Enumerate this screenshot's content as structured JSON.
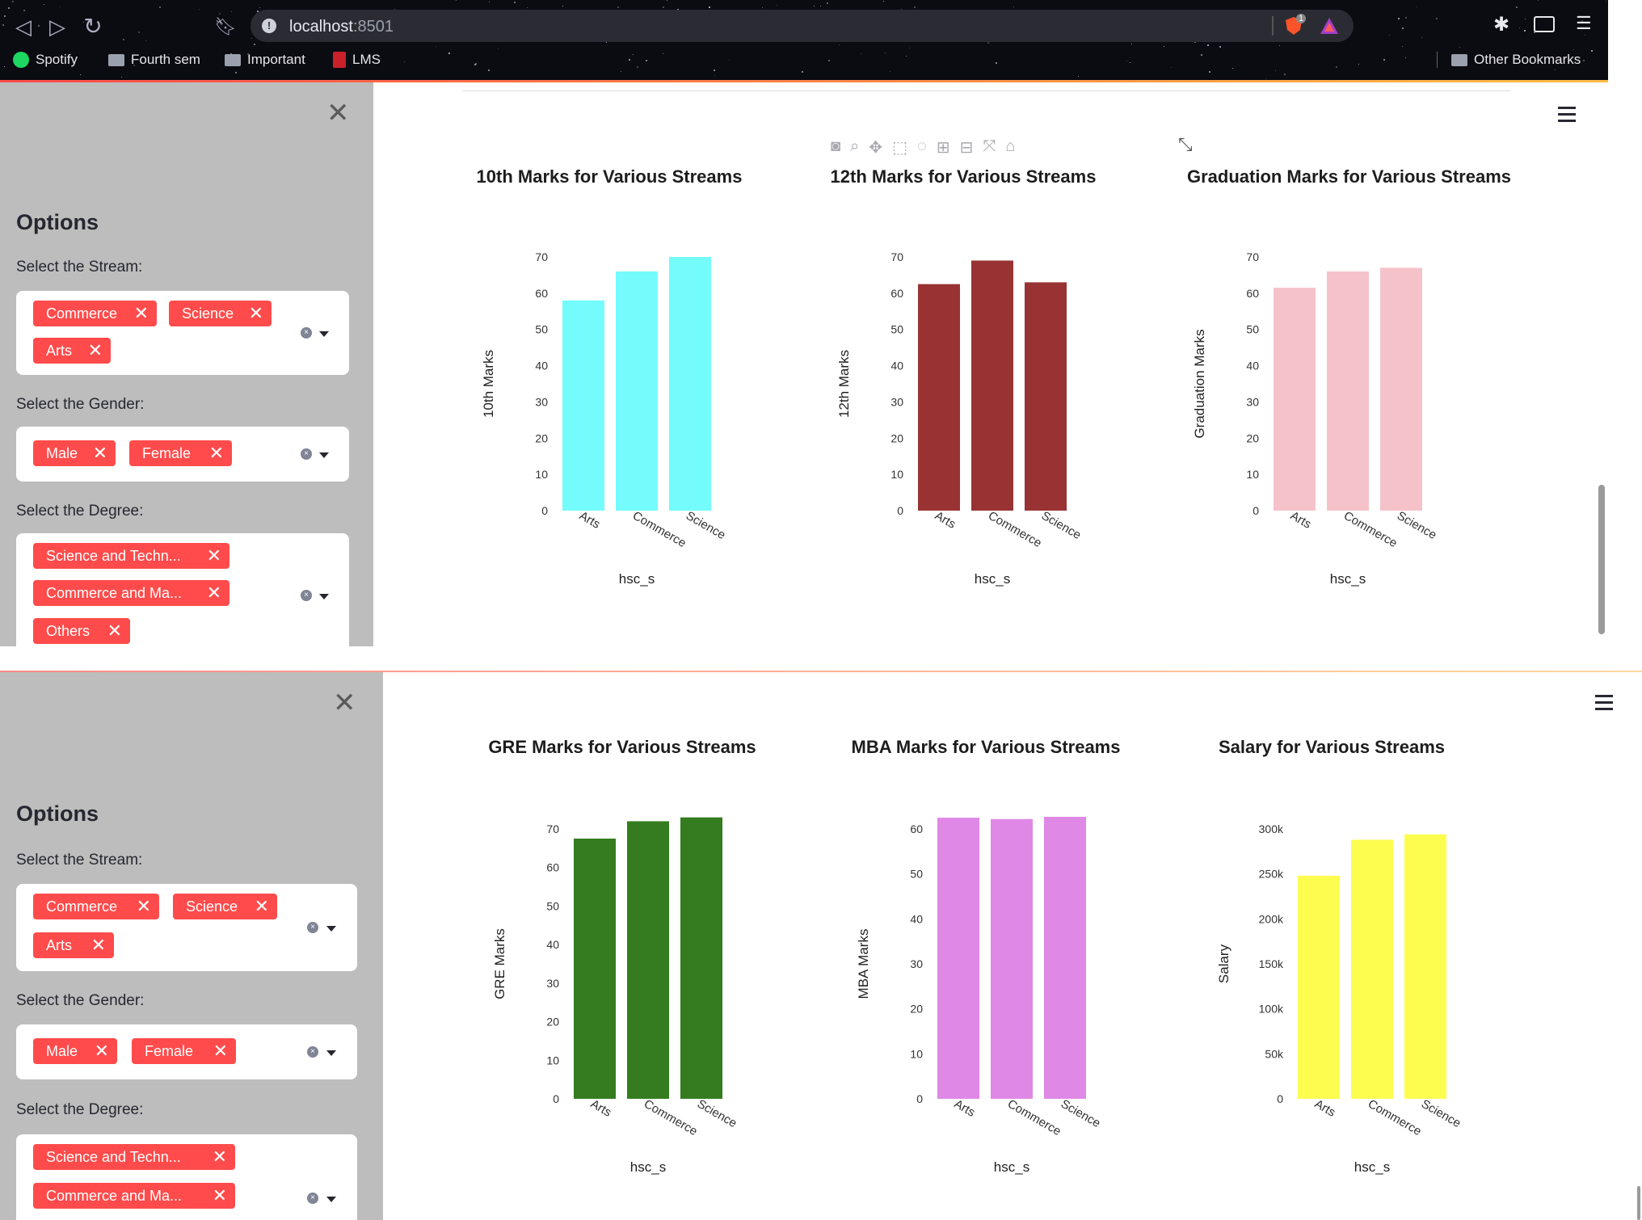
{
  "browser": {
    "url_host": "localhost",
    "url_port": ":8501",
    "shield_count": "1",
    "bookmarks": [
      {
        "label": "Spotify",
        "icon": "spotify-icon"
      },
      {
        "label": "Fourth sem",
        "icon": "folder-icon"
      },
      {
        "label": "Important",
        "icon": "folder-icon"
      },
      {
        "label": "LMS",
        "icon": "lms-icon"
      }
    ],
    "other_bookmarks": "Other Bookmarks"
  },
  "top": {
    "sidebar": {
      "title": "Options",
      "stream_label": "Select the Stream:",
      "streams": [
        "Commerce",
        "Science",
        "Arts"
      ],
      "gender_label": "Select the Gender:",
      "genders": [
        "Male",
        "Female"
      ],
      "degree_label": "Select the Degree:",
      "degrees": [
        "Science and Techn...",
        "Commerce and Ma...",
        "Others"
      ]
    }
  },
  "bottom": {
    "sidebar": {
      "title": "Options",
      "stream_label": "Select the Stream:",
      "streams": [
        "Commerce",
        "Science",
        "Arts"
      ],
      "gender_label": "Select the Gender:",
      "genders": [
        "Male",
        "Female"
      ],
      "degree_label": "Select the Degree:",
      "degrees": [
        "Science and Techn...",
        "Commerce and Ma..."
      ]
    }
  },
  "colors": {
    "accent": "#ff4b4b",
    "tenth": "#74fbfb",
    "twelfth": "#993333",
    "graduation": "#f5c2c9",
    "gre": "#347c1f",
    "mba": "#df88e6",
    "salary": "#fdfd50"
  },
  "chart_data": [
    {
      "type": "bar",
      "title": "10th Marks for Various Streams",
      "categories": [
        "Arts",
        "Commerce",
        "Science"
      ],
      "values": [
        58,
        66,
        70
      ],
      "xlabel": "hsc_s",
      "ylabel": "10th Marks",
      "ylim": [
        0,
        70
      ],
      "yticks": [
        "0",
        "10",
        "20",
        "30",
        "40",
        "50",
        "60",
        "70"
      ],
      "color": "#74fbfb"
    },
    {
      "type": "bar",
      "title": "12th Marks for Various Streams",
      "categories": [
        "Arts",
        "Commerce",
        "Science"
      ],
      "values": [
        62.5,
        69,
        63
      ],
      "xlabel": "hsc_s",
      "ylabel": "12th Marks",
      "ylim": [
        0,
        70
      ],
      "yticks": [
        "0",
        "10",
        "20",
        "30",
        "40",
        "50",
        "60",
        "70"
      ],
      "color": "#993333"
    },
    {
      "type": "bar",
      "title": "Graduation Marks for Various Streams",
      "categories": [
        "Arts",
        "Commerce",
        "Science"
      ],
      "values": [
        61.5,
        66,
        67
      ],
      "xlabel": "hsc_s",
      "ylabel": "Graduation Marks",
      "ylim": [
        0,
        70
      ],
      "yticks": [
        "0",
        "10",
        "20",
        "30",
        "40",
        "50",
        "60",
        "70"
      ],
      "color": "#f5c2c9"
    },
    {
      "type": "bar",
      "title": "GRE Marks for Various Streams",
      "categories": [
        "Arts",
        "Commerce",
        "Science"
      ],
      "values": [
        67.5,
        72,
        73
      ],
      "xlabel": "hsc_s",
      "ylabel": "GRE Marks",
      "ylim": [
        0,
        70
      ],
      "yticks": [
        "0",
        "10",
        "20",
        "30",
        "40",
        "50",
        "60",
        "70"
      ],
      "color": "#347c1f"
    },
    {
      "type": "bar",
      "title": "MBA Marks for Various Streams",
      "categories": [
        "Arts",
        "Commerce",
        "Science"
      ],
      "values": [
        62.5,
        62.2,
        62.7
      ],
      "xlabel": "hsc_s",
      "ylabel": "MBA Marks",
      "ylim": [
        0,
        60
      ],
      "yticks": [
        "0",
        "10",
        "20",
        "30",
        "40",
        "50",
        "60"
      ],
      "color": "#df88e6"
    },
    {
      "type": "bar",
      "title": "Salary for Various Streams",
      "categories": [
        "Arts",
        "Commerce",
        "Science"
      ],
      "values": [
        248000,
        288000,
        294000
      ],
      "xlabel": "hsc_s",
      "ylabel": "Salary",
      "ylim": [
        0,
        300000
      ],
      "yticks": [
        "0",
        "50k",
        "100k",
        "150k",
        "200k",
        "250k",
        "300k"
      ],
      "color": "#fdfd50"
    }
  ]
}
